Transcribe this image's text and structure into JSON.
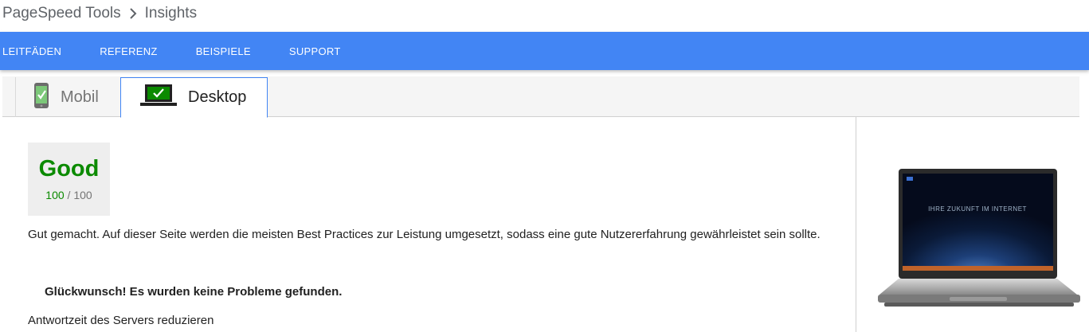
{
  "breadcrumb": {
    "root": "PageSpeed Tools",
    "current": "Insights"
  },
  "nav": {
    "items": [
      "LEITFÄDEN",
      "REFERENZ",
      "BEISPIELE",
      "SUPPORT"
    ]
  },
  "tabs": {
    "mobile": {
      "label": "Mobil",
      "icon": "phone-check-icon"
    },
    "desktop": {
      "label": "Desktop",
      "icon": "laptop-check-icon",
      "active": true
    }
  },
  "score": {
    "label": "Good",
    "value": "100",
    "separator": "/",
    "max": "100",
    "color": "#0b8a00"
  },
  "summary": "Gut gemacht. Auf dieser Seite werden die meisten Best Practices zur Leistung umgesetzt, sodass eine gute Nutzererfahrung gewährleistet sein sollte.",
  "congrats": "Glückwunsch! Es wurden keine Probleme gefunden.",
  "rules": [
    "Antwortzeit des Servers reduzieren"
  ],
  "preview": {
    "screen_text": "IHRE ZUKUNFT IM INTERNET"
  },
  "colors": {
    "nav_bg": "#4285f4",
    "accent": "#4285f4",
    "good": "#0b8a00"
  }
}
